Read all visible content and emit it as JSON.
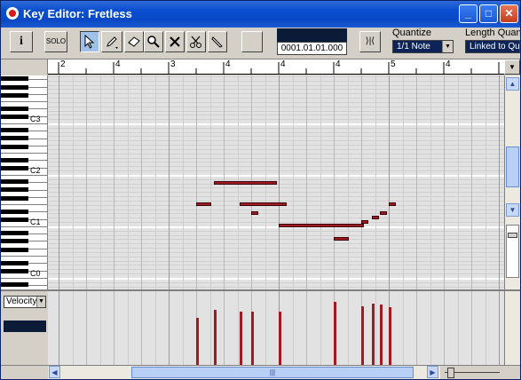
{
  "window": {
    "title": "Key Editor: Fretless",
    "minimize": "_",
    "maximize": "□",
    "close": "✕",
    "accent": "#0a4fd0"
  },
  "toolbar": {
    "info_label": "i",
    "solo_label": "SOLO",
    "tools": [
      "object-select",
      "draw",
      "erase",
      "zoom",
      "mute",
      "split",
      "glue"
    ],
    "active_tool": "object-select",
    "position": "0001.01.01.000",
    "snap_label": "⟩|⟨",
    "quantize_label": "Quantize",
    "quantize_value": "1/1 Note",
    "length_label": "Length Quantize",
    "length_value": "Linked to Quantize"
  },
  "ruler": {
    "labels": [
      "2",
      "4",
      "3",
      "4",
      "4",
      "4",
      "5",
      "4"
    ]
  },
  "keyboard": {
    "labels": [
      "C3",
      "C2",
      "C1",
      "C0"
    ]
  },
  "notes": {
    "color": "#a01a24",
    "events": [
      {
        "pitch": "C#2",
        "start": "2.4",
        "length": "quarter"
      },
      {
        "pitch": "G#1",
        "start": "3.2",
        "length": "eighth"
      },
      {
        "pitch": "G#1",
        "start": "3.3",
        "length": "beat"
      },
      {
        "pitch": "F#1",
        "start": "3.4",
        "length": "sixteenth"
      },
      {
        "pitch": "D#1",
        "start": "4.1",
        "length": "half"
      },
      {
        "pitch": "C1",
        "start": "4.3",
        "length": "eighth"
      },
      {
        "pitch": "E1",
        "start": "4.4",
        "length": "sixteenth"
      },
      {
        "pitch": "F1",
        "start": "4.4",
        "length": "sixteenth"
      },
      {
        "pitch": "F#1",
        "start": "4.4",
        "length": "sixteenth"
      },
      {
        "pitch": "G#1",
        "start": "5.1",
        "length": "sixteenth"
      }
    ]
  },
  "controller": {
    "lane": "Velocity"
  }
}
